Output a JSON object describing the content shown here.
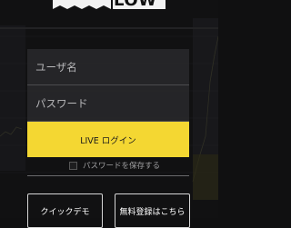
{
  "app": {
    "logo_text": "LOW"
  },
  "login_form": {
    "username_placeholder": "ユーザ名",
    "password_placeholder": "パスワード",
    "live_login_label": "LIVE ログイン",
    "save_password_label": "パスワードを保存する",
    "save_password_checked": false
  },
  "actions": {
    "quick_demo_label": "クイックデモ",
    "free_signup_label": "無料登録はこちら"
  },
  "colors": {
    "accent": "#f4d732",
    "background": "#101011"
  }
}
